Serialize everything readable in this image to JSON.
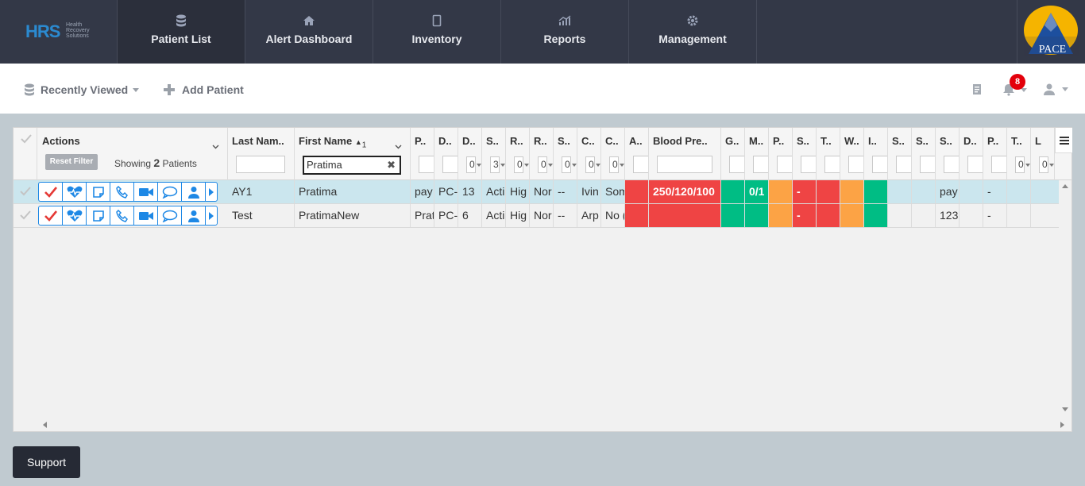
{
  "app": {
    "logo_text": "HRS",
    "logo_sub": "Health Recovery Solutions",
    "brand_text": "PACE"
  },
  "nav": [
    {
      "label": "Patient List",
      "icon": "database-icon"
    },
    {
      "label": "Alert Dashboard",
      "icon": "home-icon"
    },
    {
      "label": "Inventory",
      "icon": "tablet-icon"
    },
    {
      "label": "Reports",
      "icon": "chart-icon"
    },
    {
      "label": "Management",
      "icon": "gear-icon"
    }
  ],
  "toolbar": {
    "recently_viewed": "Recently Viewed",
    "add_patient": "Add Patient",
    "notification_count": "8"
  },
  "grid": {
    "actions_header": "Actions",
    "reset_filter": "Reset Filter",
    "showing_prefix": "Showing",
    "showing_count": "2",
    "showing_suffix": "Patients",
    "columns": [
      "Last Nam..",
      "First Name",
      "P..",
      "D..",
      "D..",
      "S..",
      "R..",
      "R..",
      "S..",
      "C..",
      "C..",
      "A..",
      "Blood Pre..",
      "G..",
      "M..",
      "P..",
      "S..",
      "T..",
      "W..",
      "I..",
      "S..",
      "S..",
      "S..",
      "D..",
      "P..",
      "T..",
      "L"
    ],
    "sort_indicator": "1",
    "first_name_filter": "Pratima",
    "select_filters": [
      "0",
      "3",
      "0",
      "0",
      "0",
      "0",
      "0",
      "0",
      "0"
    ],
    "rows": [
      {
        "last": "AY1",
        "first": "Pratima",
        "c1": "pay",
        "c2": "PC-",
        "c3": "13",
        "c4": "Acti",
        "c5": "Hig",
        "c6": "Nor",
        "c7": "--",
        "c8": "Ivin",
        "c9": "Som",
        "bp": "250/120/100",
        "m": "0/1",
        "s": "-",
        "s3": "pay",
        "p": "-"
      },
      {
        "last": "Test",
        "first": "PratimaNew",
        "c1": "Prat",
        "c2": "PC-",
        "c3": "6",
        "c4": "Acti",
        "c5": "Hig",
        "c6": "Nor",
        "c7": "--",
        "c8": "Arp",
        "c9": "No (",
        "bp": "",
        "m": "",
        "s": "-",
        "s3": "123",
        "p": "-"
      }
    ]
  },
  "colors": {
    "alert_red": "#ef4444",
    "ok_green": "#00bd84",
    "warn_orange": "#fca345",
    "action_blue": "#1e88e5"
  },
  "support": "Support"
}
